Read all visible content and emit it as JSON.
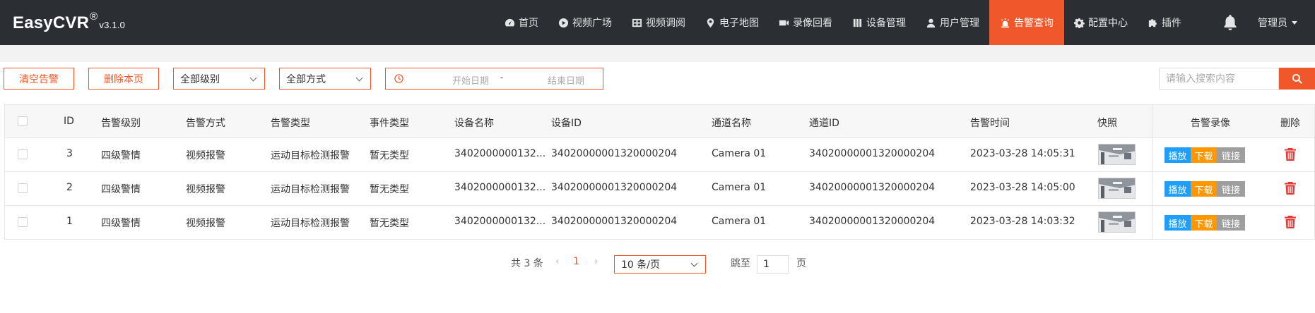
{
  "app": {
    "brand": "EasyCVR",
    "registered": "®",
    "version": "v3.1.0"
  },
  "nav": [
    {
      "label": "首页",
      "icon": "dashboard-icon"
    },
    {
      "label": "视频广场",
      "icon": "play-circle-icon"
    },
    {
      "label": "视频调阅",
      "icon": "grid-icon"
    },
    {
      "label": "电子地图",
      "icon": "map-marker-icon"
    },
    {
      "label": "录像回看",
      "icon": "video-camera-icon"
    },
    {
      "label": "设备管理",
      "icon": "columns-icon"
    },
    {
      "label": "用户管理",
      "icon": "user-icon"
    },
    {
      "label": "告警查询",
      "icon": "alarm-icon",
      "active": true
    },
    {
      "label": "配置中心",
      "icon": "gear-icon"
    },
    {
      "label": "插件",
      "icon": "puzzle-icon"
    }
  ],
  "user": {
    "name": "管理员"
  },
  "toolbar": {
    "clear_alarms": "清空告警",
    "delete_page": "删除本页",
    "level_select": "全部级别",
    "method_select": "全部方式",
    "date_start_placeholder": "开始日期",
    "date_separator": "-",
    "date_end_placeholder": "结束日期",
    "search_placeholder": "请输入搜索内容"
  },
  "table": {
    "headers": {
      "id": "ID",
      "level": "告警级别",
      "method": "告警方式",
      "type": "告警类型",
      "event": "事件类型",
      "device_name": "设备名称",
      "device_id": "设备ID",
      "channel_name": "通道名称",
      "channel_id": "通道ID",
      "time": "告警时间",
      "snapshot": "快照",
      "recording": "告警录像",
      "delete": "删除"
    },
    "rows": [
      {
        "id": "3",
        "level": "四级警情",
        "method": "视频报警",
        "type": "运动目标检测报警",
        "event": "暂无类型",
        "device_name": "3402000000132...",
        "device_id": "34020000001320000204",
        "channel_name": "Camera 01",
        "channel_id": "34020000001320000204",
        "time": "2023-03-28 14:05:31"
      },
      {
        "id": "2",
        "level": "四级警情",
        "method": "视频报警",
        "type": "运动目标检测报警",
        "event": "暂无类型",
        "device_name": "3402000000132...",
        "device_id": "34020000001320000204",
        "channel_name": "Camera 01",
        "channel_id": "34020000001320000204",
        "time": "2023-03-28 14:05:00"
      },
      {
        "id": "1",
        "level": "四级警情",
        "method": "视频报警",
        "type": "运动目标检测报警",
        "event": "暂无类型",
        "device_name": "3402000000132...",
        "device_id": "34020000001320000204",
        "channel_name": "Camera 01",
        "channel_id": "34020000001320000204",
        "time": "2023-03-28 14:03:32"
      }
    ],
    "actions": {
      "play": "播放",
      "download": "下载",
      "link": "链接"
    }
  },
  "pagination": {
    "total": "共 3 条",
    "current": "1",
    "page_size": "10 条/页",
    "goto_label": "跳至",
    "goto_value": "1",
    "page_unit": "页"
  },
  "colors": {
    "accent": "#f0572a",
    "topbar": "#2b2e33",
    "play": "#1e9fff",
    "download": "#ff9800",
    "link": "#9e9e9e",
    "trash": "#e53935"
  }
}
